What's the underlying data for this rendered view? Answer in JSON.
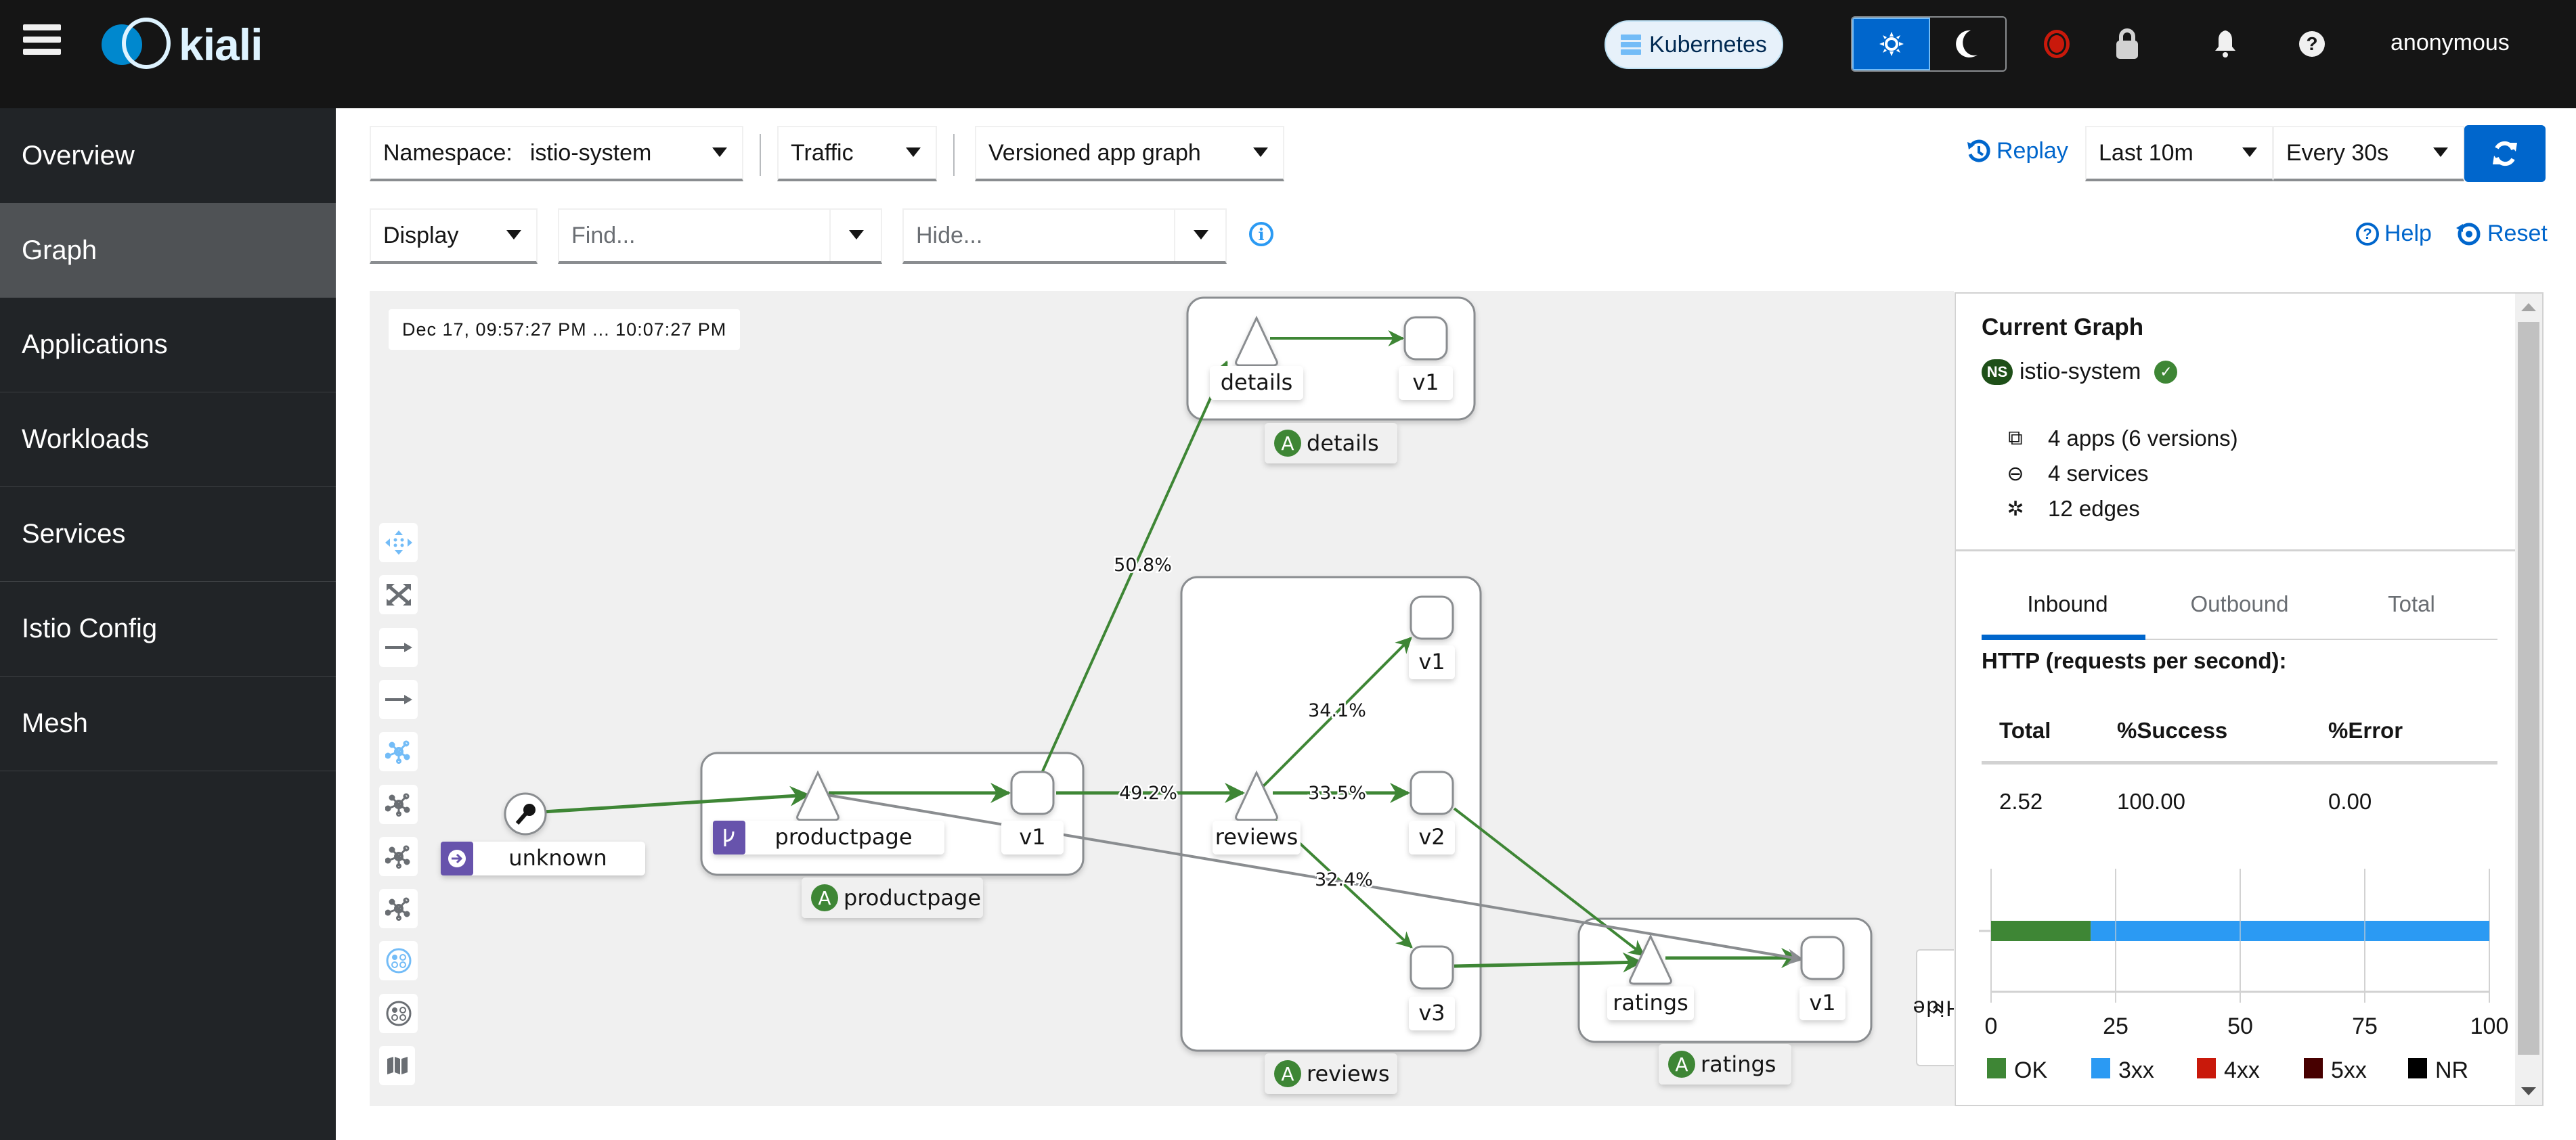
{
  "header": {
    "brand": "kiali",
    "cluster_badge": "Kubernetes",
    "theme_light_icon": "sun-icon",
    "theme_dark_icon": "moon-icon",
    "user": "anonymous"
  },
  "sidebar": {
    "items": [
      {
        "label": "Overview",
        "active": false
      },
      {
        "label": "Graph",
        "active": true
      },
      {
        "label": "Applications",
        "active": false
      },
      {
        "label": "Workloads",
        "active": false
      },
      {
        "label": "Services",
        "active": false
      },
      {
        "label": "Istio Config",
        "active": false
      },
      {
        "label": "Mesh",
        "active": false
      }
    ]
  },
  "toolbar": {
    "namespace_label": "Namespace:",
    "namespace_value": "istio-system",
    "traffic": "Traffic",
    "graph_type": "Versioned app graph",
    "replay": "Replay",
    "duration": "Last 10m",
    "refresh_interval": "Every 30s",
    "display": "Display",
    "find_placeholder": "Find...",
    "hide_placeholder": "Hide...",
    "help": "Help",
    "reset": "Reset"
  },
  "graph": {
    "timestamp": "Dec 17, 09:57:27 PM ... 10:07:27 PM",
    "toolbar_icons": [
      "drag-icon",
      "fit-icon",
      "edge-arrow-icon",
      "edge-arrow-icon",
      "layout-default-icon",
      "layout-1-icon",
      "layout-2-icon",
      "layout-3-icon",
      "namespace-layout-icon",
      "namespace-layout-2-icon",
      "legend-map-icon"
    ],
    "hide_tab": "Hide",
    "boxes": [
      {
        "id": "box-details",
        "app": "details"
      },
      {
        "id": "box-productpage",
        "app": "productpage"
      },
      {
        "id": "box-reviews",
        "app": "reviews"
      },
      {
        "id": "box-ratings",
        "app": "ratings"
      }
    ],
    "nodes": [
      {
        "id": "unknown",
        "type": "unknown",
        "label": "unknown"
      },
      {
        "id": "svc-productpage",
        "type": "service",
        "label": "productpage",
        "badge": "virtual-service"
      },
      {
        "id": "wl-productpage-v1",
        "type": "workload",
        "label": "v1"
      },
      {
        "id": "svc-details",
        "type": "service",
        "label": "details"
      },
      {
        "id": "wl-details-v1",
        "type": "workload",
        "label": "v1"
      },
      {
        "id": "svc-reviews",
        "type": "service",
        "label": "reviews"
      },
      {
        "id": "wl-reviews-v1",
        "type": "workload",
        "label": "v1"
      },
      {
        "id": "wl-reviews-v2",
        "type": "workload",
        "label": "v2"
      },
      {
        "id": "wl-reviews-v3",
        "type": "workload",
        "label": "v3"
      },
      {
        "id": "svc-ratings",
        "type": "service",
        "label": "ratings"
      },
      {
        "id": "wl-ratings-v1",
        "type": "workload",
        "label": "v1"
      }
    ],
    "edges": [
      {
        "from": "unknown",
        "to": "svc-productpage",
        "color": "green",
        "label": ""
      },
      {
        "from": "svc-productpage",
        "to": "wl-productpage-v1",
        "color": "green",
        "label": ""
      },
      {
        "from": "wl-productpage-v1",
        "to": "svc-details",
        "color": "green",
        "label": "50.8%"
      },
      {
        "from": "wl-productpage-v1",
        "to": "svc-reviews",
        "color": "green",
        "label": "49.2%"
      },
      {
        "from": "svc-details",
        "to": "wl-details-v1",
        "color": "green",
        "label": ""
      },
      {
        "from": "svc-reviews",
        "to": "wl-reviews-v1",
        "color": "green",
        "label": "34.1%"
      },
      {
        "from": "svc-reviews",
        "to": "wl-reviews-v2",
        "color": "green",
        "label": "33.5%"
      },
      {
        "from": "svc-reviews",
        "to": "wl-reviews-v3",
        "color": "green",
        "label": "32.4%"
      },
      {
        "from": "wl-reviews-v2",
        "to": "svc-ratings",
        "color": "green",
        "label": ""
      },
      {
        "from": "wl-reviews-v3",
        "to": "svc-ratings",
        "color": "green",
        "label": ""
      },
      {
        "from": "svc-ratings",
        "to": "wl-ratings-v1",
        "color": "green",
        "label": ""
      },
      {
        "from": "svc-productpage",
        "to": "wl-ratings-v1",
        "color": "gray",
        "label": ""
      }
    ]
  },
  "panel": {
    "title": "Current Graph",
    "ns_badge": "NS",
    "namespace": "istio-system",
    "stats": [
      {
        "icon": "applications-icon",
        "text": "4 apps (6 versions)"
      },
      {
        "icon": "services-icon",
        "text": "4 services"
      },
      {
        "icon": "edges-icon",
        "text": "12 edges"
      }
    ],
    "tabs": [
      {
        "label": "Inbound",
        "active": true
      },
      {
        "label": "Outbound",
        "active": false
      },
      {
        "label": "Total",
        "active": false
      }
    ],
    "http_title": "HTTP (requests per second):",
    "table": {
      "headers": [
        "Total",
        "%Success",
        "%Error"
      ],
      "rows": [
        [
          "2.52",
          "100.00",
          "0.00"
        ]
      ]
    }
  },
  "colors": {
    "accent": "#0066cc",
    "edge_ok": "#3e8635",
    "edge_idle": "#8a8d90",
    "header_bg": "#151515",
    "sidebar_bg": "#212427"
  },
  "chart_data": {
    "type": "bar",
    "orientation": "horizontal-stacked",
    "categories": [
      ""
    ],
    "series": [
      {
        "name": "OK",
        "color": "#3e8635",
        "values": [
          20
        ]
      },
      {
        "name": "3xx",
        "color": "#2b9af3",
        "values": [
          80
        ]
      },
      {
        "name": "4xx",
        "color": "#c9190b",
        "values": [
          0
        ]
      },
      {
        "name": "5xx",
        "color": "#470000",
        "values": [
          0
        ]
      },
      {
        "name": "NR",
        "color": "#000000",
        "values": [
          0
        ]
      }
    ],
    "xlim": [
      0,
      100
    ],
    "xticks": [
      0,
      25,
      50,
      75,
      100
    ],
    "grid": true,
    "legend": "bottom"
  }
}
